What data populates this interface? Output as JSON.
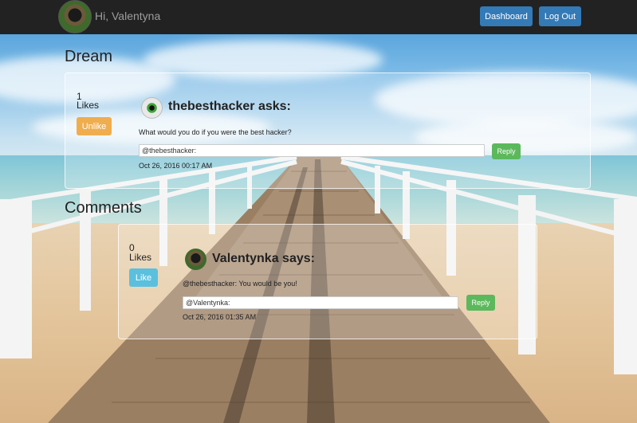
{
  "navbar": {
    "greeting": "Hi, Valentyna",
    "dashboard_label": "Dashboard",
    "logout_label": "Log Out"
  },
  "dream": {
    "section_title": "Dream",
    "likes_count": "1",
    "likes_label": "Likes",
    "unlike_label": "Unlike",
    "asker_heading": "thebesthacker asks:",
    "question": "What would you do if you were the best hacker?",
    "reply_value": "@thebesthacker:",
    "reply_button": "Reply",
    "timestamp": "Oct 26, 2016 00:17 AM"
  },
  "comments": {
    "section_title": "Comments",
    "items": [
      {
        "likes_count": "0",
        "likes_label": "Likes",
        "like_label": "Like",
        "author_heading": "Valentynka says:",
        "text": "@thebesthacker: You would be you!",
        "reply_value": "@Valentynka:",
        "reply_button": "Reply",
        "timestamp": "Oct 26, 2016 01:35 AM"
      }
    ]
  },
  "colors": {
    "navbar_bg": "#222222",
    "primary": "#337ab7",
    "warning": "#f0ad4e",
    "info": "#5bc0de",
    "success": "#5cb85c"
  }
}
